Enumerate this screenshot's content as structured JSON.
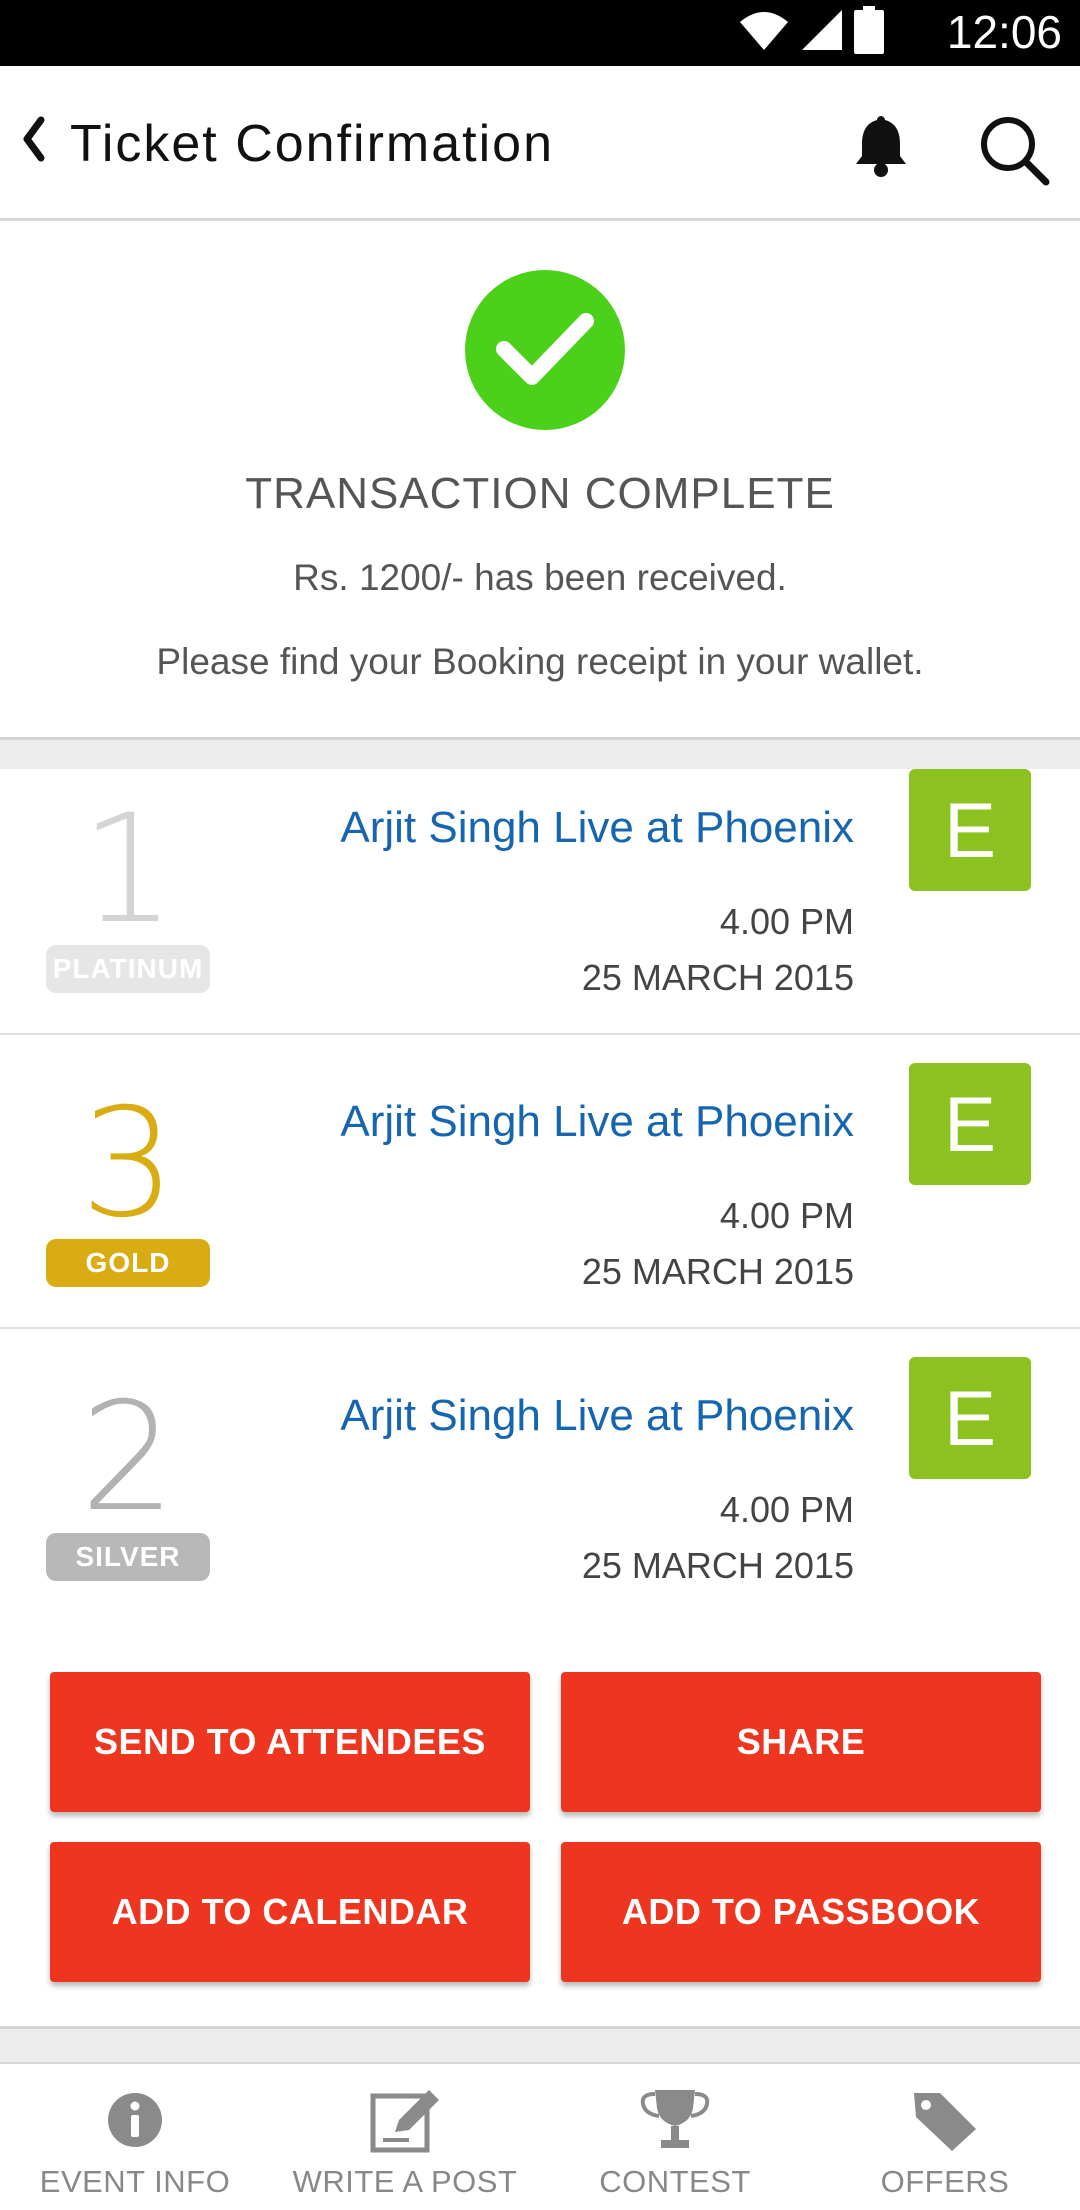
{
  "status_bar": {
    "time": "12:06",
    "icons": [
      "wifi-icon",
      "signal-icon",
      "battery-icon"
    ]
  },
  "app_bar": {
    "title": "Ticket Confirmation",
    "icons": [
      "back-chevron-icon",
      "bell-icon",
      "search-icon"
    ]
  },
  "confirmation": {
    "title": "TRANSACTION COMPLETE",
    "amount_text": "Rs. 1200/- has been received.",
    "note": "Please find your Booking receipt in your wallet.",
    "accent_color": "#4cd11a"
  },
  "tickets": [
    {
      "count": "1",
      "tier": "PLATINUM",
      "event_name": "Arjit Singh Live at Phoenix",
      "time": "4.00 PM",
      "date": "25 MARCH 2015",
      "badge": "E"
    },
    {
      "count": "3",
      "tier": "GOLD",
      "event_name": "Arjit Singh Live at Phoenix",
      "time": "4.00 PM",
      "date": "25 MARCH 2015",
      "badge": "E"
    },
    {
      "count": "2",
      "tier": "SILVER",
      "event_name": "Arjit Singh Live at Phoenix",
      "time": "4.00 PM",
      "date": "25 MARCH 2015",
      "badge": "E"
    }
  ],
  "actions": {
    "send_to_attendees": "SEND TO ATTENDEES",
    "share": "SHARE",
    "add_to_calendar": "ADD TO CALENDAR",
    "add_to_passbook": "ADD TO PASSBOOK",
    "button_color": "#ee3520"
  },
  "bottom_nav": [
    {
      "label": "EVENT INFO",
      "icon": "info-icon"
    },
    {
      "label": "WRITE A POST",
      "icon": "edit-icon"
    },
    {
      "label": "CONTEST",
      "icon": "trophy-icon"
    },
    {
      "label": "OFFERS",
      "icon": "tag-icon"
    }
  ]
}
